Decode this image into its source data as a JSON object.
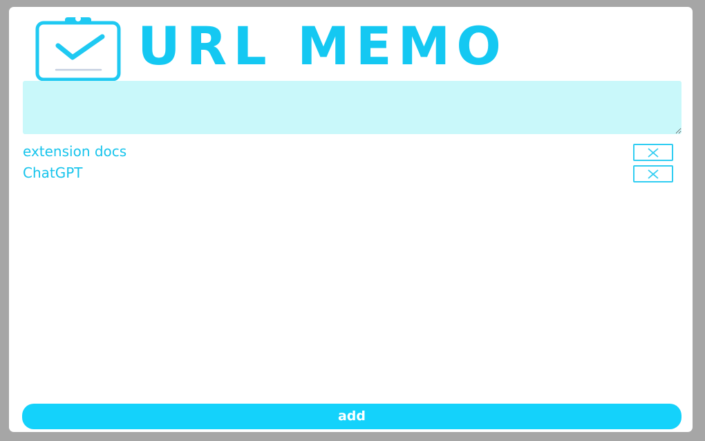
{
  "app": {
    "title": "URL MEMO"
  },
  "memo_input": {
    "value": "",
    "placeholder": ""
  },
  "memos": [
    {
      "label": "extension docs"
    },
    {
      "label": "ChatGPT"
    }
  ],
  "add_button": {
    "label": "add"
  },
  "icons": {
    "logo": "clipboard-check-icon",
    "delete": "close-x-icon"
  },
  "colors": {
    "accent": "#14c8f2",
    "input_background": "#c9f8fa",
    "button_background": "#14d2fb",
    "window_backdrop": "#a6a6a6"
  }
}
